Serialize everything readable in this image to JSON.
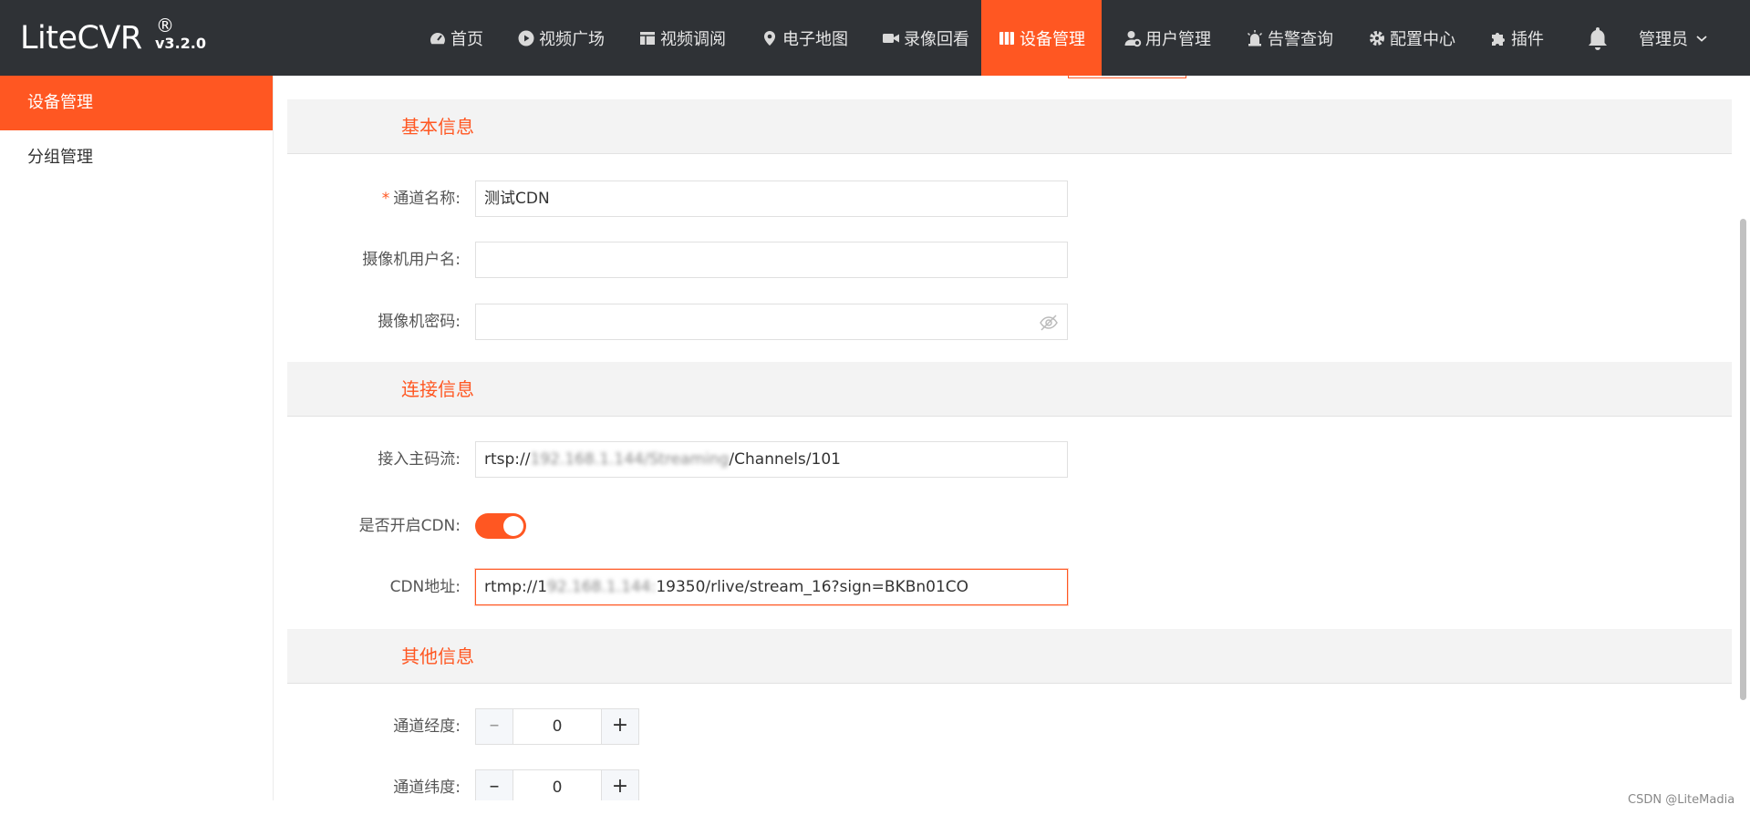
{
  "app": {
    "name": "LiteCVR",
    "registered": "®",
    "version": "v3.2.0"
  },
  "nav": {
    "items": [
      {
        "label": "首页",
        "icon": "dashboard-icon"
      },
      {
        "label": "视频广场",
        "icon": "play-circle-icon"
      },
      {
        "label": "视频调阅",
        "icon": "layout-icon"
      },
      {
        "label": "电子地图",
        "icon": "map-pin-icon"
      },
      {
        "label": "录像回看",
        "icon": "video-camera-icon"
      },
      {
        "label": "设备管理",
        "icon": "device-icon",
        "active": true
      },
      {
        "label": "用户管理",
        "icon": "user-gear-icon"
      },
      {
        "label": "告警查询",
        "icon": "alarm-icon"
      },
      {
        "label": "配置中心",
        "icon": "gear-icon"
      },
      {
        "label": "插件",
        "icon": "puzzle-icon"
      }
    ],
    "bell_icon": "bell-icon",
    "user_label": "管理员"
  },
  "sidebar": {
    "items": [
      {
        "label": "设备管理",
        "active": true
      },
      {
        "label": "分组管理",
        "active": false
      }
    ]
  },
  "form": {
    "sections": {
      "basic": "基本信息",
      "connection": "连接信息",
      "other": "其他信息"
    },
    "channel_name": {
      "required_mark": "*",
      "label": "通道名称:",
      "value": "测试CDN"
    },
    "camera_user": {
      "label": "摄像机用户名:",
      "value": ""
    },
    "camera_password": {
      "label": "摄像机密码:",
      "value": ""
    },
    "main_stream": {
      "label": "接入主码流:",
      "prefix": "rtsp://",
      "masked": "192.168.1.144/Streaming",
      "suffix": "/Channels/101"
    },
    "cdn_enabled": {
      "label": "是否开启CDN:",
      "value": true
    },
    "cdn_address": {
      "label": "CDN地址:",
      "prefix": "rtmp://1",
      "masked": "92.168.1.144:",
      "suffix": "19350/rlive/stream_16?sign=BKBn01CO"
    },
    "longitude": {
      "label": "通道经度:",
      "value": "0",
      "minus": "–",
      "plus": "+"
    },
    "latitude": {
      "label": "通道纬度:",
      "value": "0",
      "minus": "–",
      "plus": "+"
    }
  },
  "watermark": "CSDN @LiteMadia",
  "colors": {
    "accent": "#ff5722",
    "topbar": "#2f3236"
  }
}
